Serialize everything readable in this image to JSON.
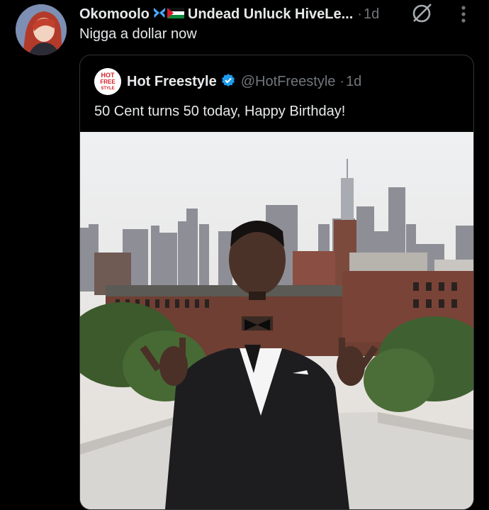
{
  "post": {
    "author_name": "Okomoolo",
    "author_handle": "Undead Unluck HiveLe...",
    "separator": "·",
    "time": "1d",
    "text": "Nigga a dollar now"
  },
  "quote": {
    "logo_text": [
      "HOT",
      "FREE",
      "STYLE"
    ],
    "author_name": "Hot Freestyle",
    "author_handle": "@HotFreestyle",
    "separator": "·",
    "time": "1d",
    "text": "50 Cent turns 50 today, Happy Birthday!"
  },
  "icons": {
    "flag": "butterfly-palestine-flag-icon",
    "grok": "grok-icon",
    "more": "more-vertical-icon",
    "verified": "verified-badge-icon"
  },
  "colors": {
    "background": "#000000",
    "text": "#e7e9ea",
    "muted": "#71767b",
    "verified": "#1d9bf0",
    "border": "#2f3336"
  }
}
